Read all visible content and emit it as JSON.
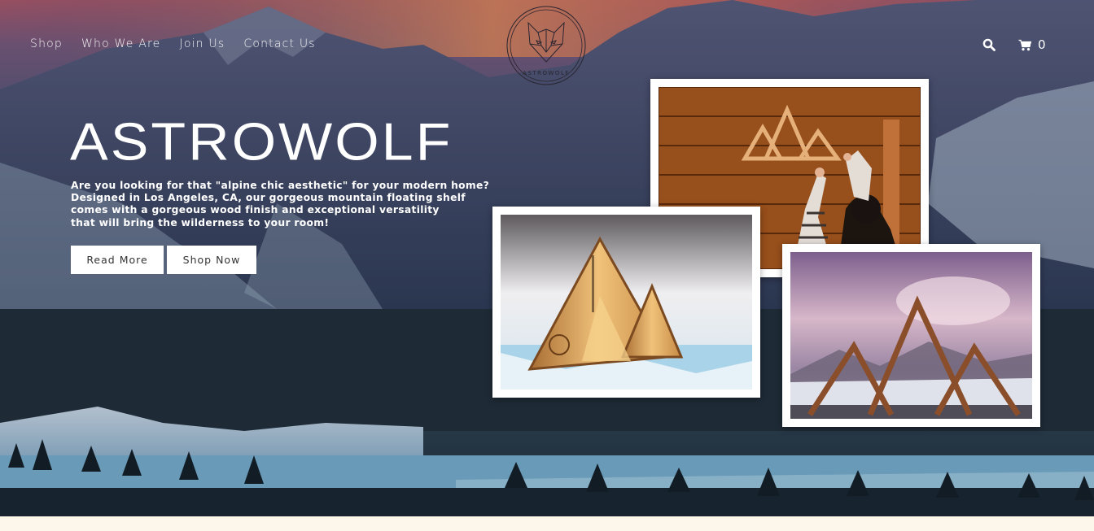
{
  "nav": {
    "items": [
      "Shop",
      "Who We Are",
      "Join Us",
      "Contact Us"
    ]
  },
  "logo": {
    "text": "ASTROWOLF",
    "icon": "wolf-head-icon"
  },
  "header_icons": {
    "search_icon": "search-icon",
    "cart_icon": "cart-icon",
    "cart_count": "0"
  },
  "hero": {
    "title": "ASTROWOLF",
    "tagline_lines": [
      "Are you looking for that \"alpine chic aesthetic\" for your modern home?",
      "Designed in Los Angeles, CA, our gorgeous mountain floating shelf",
      "comes with a gorgeous wood finish and exceptional versatility",
      "that will bring the wilderness to your room!"
    ],
    "read_more_label": "Read More",
    "shop_now_label": "Shop Now"
  },
  "colors": {
    "text": "#ffffff",
    "button_bg": "#ffffff",
    "footer_strip": "#fdf6ea",
    "wood": "#c8925a"
  }
}
